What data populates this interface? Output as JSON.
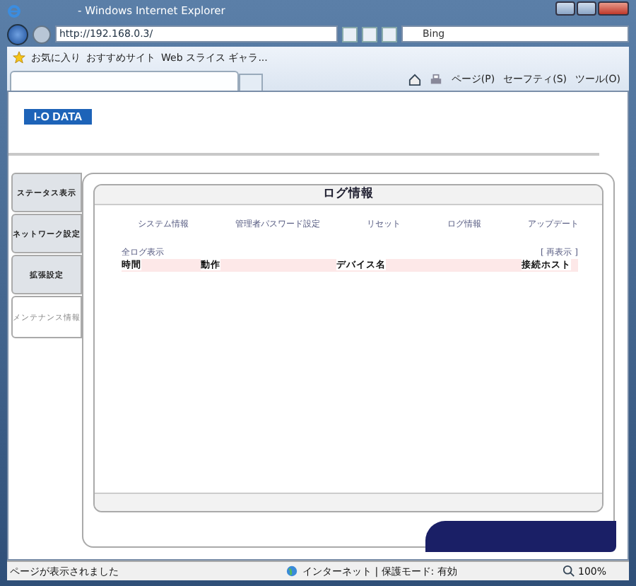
{
  "window": {
    "title": "- Windows Internet Explorer"
  },
  "nav": {
    "address": "http://192.168.0.3/",
    "search_placeholder": "Bing"
  },
  "favorites": {
    "label": "お気に入り",
    "items": [
      {
        "label": "おすすめサイト"
      },
      {
        "label": "Web スライス ギャラ..."
      }
    ]
  },
  "command_bar": [
    "ページ(P)",
    "セーフティ(S)",
    "ツール(O)"
  ],
  "page": {
    "logo": "I-O DATA",
    "sidebar": [
      {
        "label": "ステータス表示",
        "selected": false
      },
      {
        "label": "ネットワーク設定",
        "selected": false
      },
      {
        "label": "拡張設定",
        "selected": false
      },
      {
        "label": "メンテナンス情報",
        "selected": true
      }
    ],
    "panel": {
      "title": "ログ情報",
      "links": [
        "システム情報",
        "管理者パスワード設定",
        "リセット",
        "ログ情報",
        "アップデート"
      ],
      "all_logs": "全ログ表示",
      "refresh": "[ 再表示 ]",
      "columns": [
        "時間",
        "動作",
        "デバイス名",
        "接続ホスト"
      ]
    }
  },
  "status_bar": {
    "text": "ページが表示されました",
    "zone": "インターネット | 保護モード: 有効",
    "zoom": "100%"
  }
}
